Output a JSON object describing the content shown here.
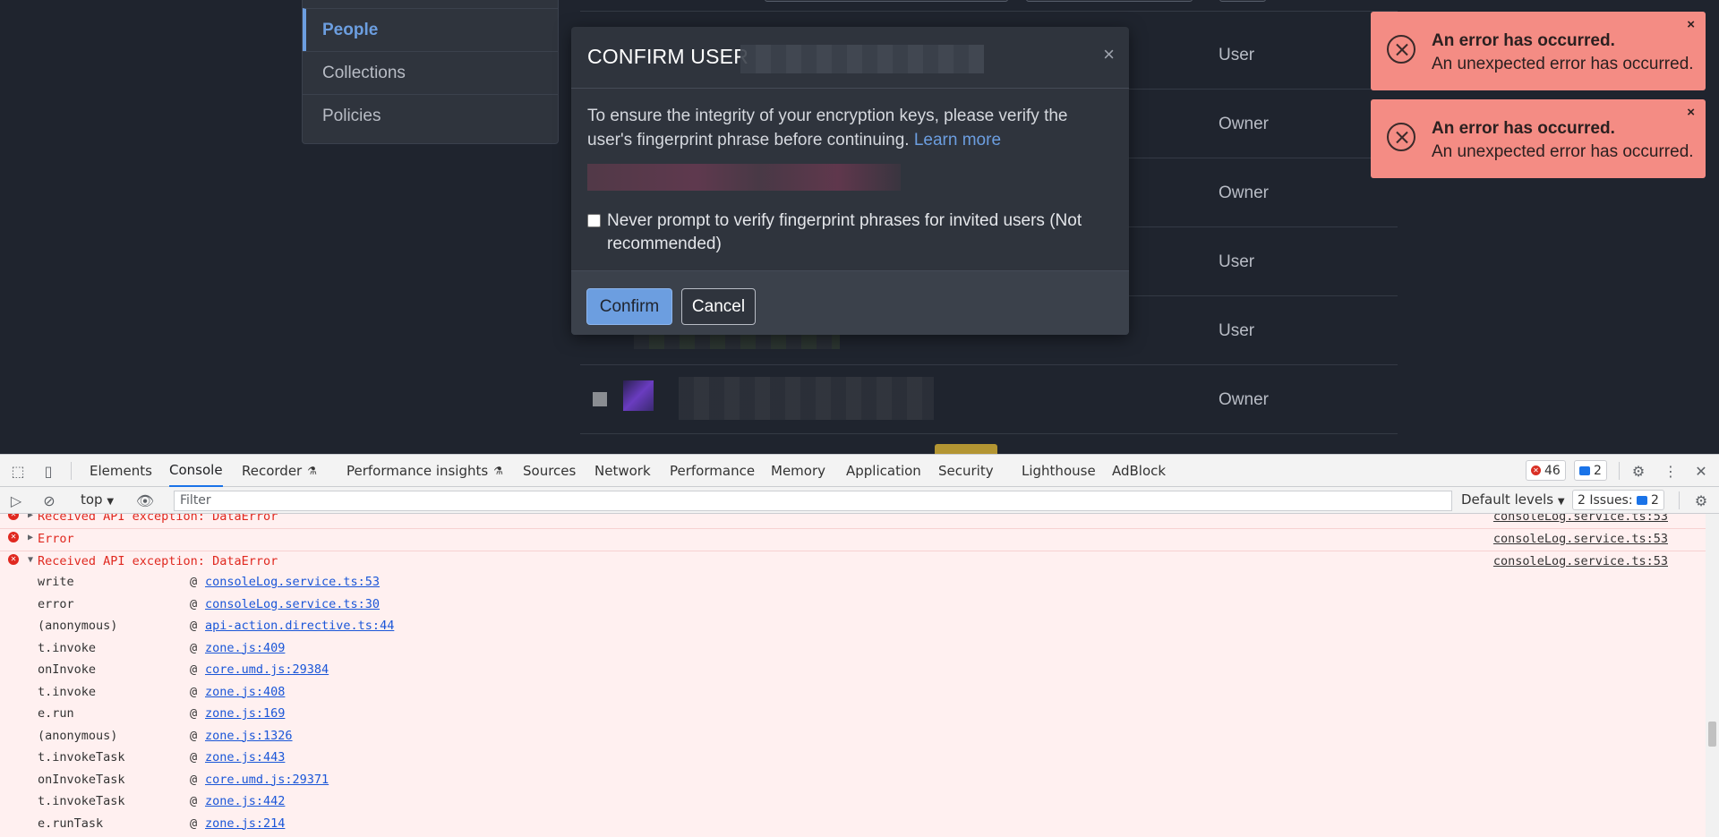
{
  "app": {
    "nav_items": [
      {
        "label": "People",
        "active": true
      },
      {
        "label": "Collections",
        "active": false
      },
      {
        "label": "Policies",
        "active": false
      }
    ],
    "roles": [
      "User",
      "Owner",
      "Owner",
      "User",
      "User",
      "Owner"
    ]
  },
  "modal": {
    "title": "CONFIRM USER",
    "close": "×",
    "body_text": "To ensure the integrity of your encryption keys, please verify the user's fingerprint phrase before continuing.",
    "learn_more": "Learn more",
    "checkbox_label": "Never prompt to verify fingerprint phrases for invited users (Not recommended)",
    "confirm": "Confirm",
    "cancel": "Cancel"
  },
  "toasts": [
    {
      "title": "An error has occurred.",
      "message": "An unexpected error has occurred.",
      "close": "×"
    },
    {
      "title": "An error has occurred.",
      "message": "An unexpected error has occurred.",
      "close": "×"
    }
  ],
  "devtools": {
    "tabs": [
      "Elements",
      "Console",
      "Recorder",
      "Performance insights",
      "Sources",
      "Network",
      "Performance",
      "Memory",
      "Application",
      "Security",
      "Lighthouse",
      "AdBlock"
    ],
    "active_tab": "Console",
    "error_count": "46",
    "message_count": "2",
    "context": "top",
    "filter_placeholder": "Filter",
    "levels": "Default levels",
    "issues_label": "2 Issues:",
    "issues_count": "2",
    "logs": [
      {
        "message": "Received API exception: DataError",
        "source": "consoleLog.service.ts:53",
        "expanded": false
      },
      {
        "message": "Error",
        "source": "consoleLog.service.ts:53",
        "expanded": false
      },
      {
        "message": "Received API exception: DataError",
        "source": "consoleLog.service.ts:53",
        "expanded": true
      }
    ],
    "stack": [
      {
        "fn": "write",
        "link": "consoleLog.service.ts:53"
      },
      {
        "fn": "error",
        "link": "consoleLog.service.ts:30"
      },
      {
        "fn": "(anonymous)",
        "link": "api-action.directive.ts:44"
      },
      {
        "fn": "t.invoke",
        "link": "zone.js:409"
      },
      {
        "fn": "onInvoke",
        "link": "core.umd.js:29384"
      },
      {
        "fn": "t.invoke",
        "link": "zone.js:408"
      },
      {
        "fn": "e.run",
        "link": "zone.js:169"
      },
      {
        "fn": "(anonymous)",
        "link": "zone.js:1326"
      },
      {
        "fn": "t.invokeTask",
        "link": "zone.js:443"
      },
      {
        "fn": "onInvokeTask",
        "link": "core.umd.js:29371"
      },
      {
        "fn": "t.invokeTask",
        "link": "zone.js:442"
      },
      {
        "fn": "e.runTask",
        "link": "zone.js:214"
      }
    ]
  }
}
